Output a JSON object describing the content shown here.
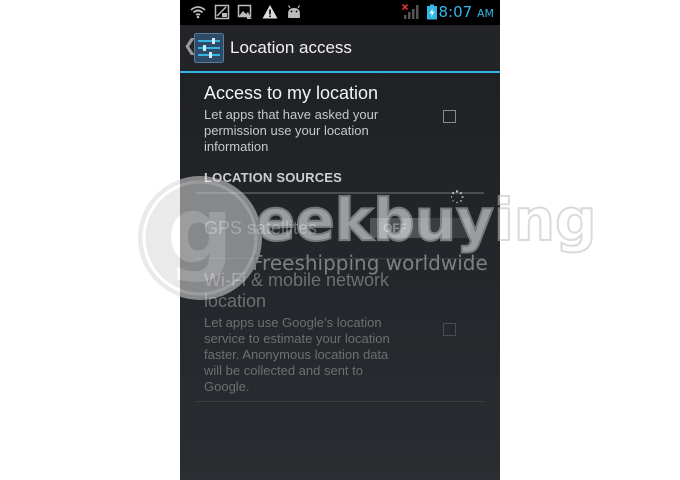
{
  "status_bar": {
    "time": "8:07",
    "ampm": "AM",
    "left_icons": [
      "wifi-icon",
      "screenshot-icon",
      "gallery-icon",
      "warning-icon",
      "android-icon"
    ],
    "right_icons": [
      "no-signal-icon",
      "battery-charging-icon"
    ],
    "accent_color": "#33b5e5"
  },
  "action_bar": {
    "title": "Location access",
    "app_icon": "location-settings-icon",
    "up_icon": "chevron-left-icon",
    "accent_color": "#33b5e5"
  },
  "prefs": {
    "access": {
      "title": "Access to my location",
      "summary_lines": [
        "Let apps that have asked your",
        "permission use your location",
        "information"
      ],
      "checked": false
    },
    "section_header": "LOCATION SOURCES",
    "gps": {
      "title": "GPS satellites",
      "toggle_label": "OFF",
      "enabled": false
    },
    "wifi": {
      "title_lines": [
        "Wi-Fi & mobile network",
        "location"
      ],
      "summary_lines": [
        "Let apps use Google’s location",
        "service to estimate your location",
        "faster. Anonymous location data",
        "will be collected and sent to",
        "Google."
      ],
      "checked": false,
      "enabled": false
    }
  },
  "watermark": {
    "brand": "eekbuying",
    "tagline": "Freeshipping worldwide",
    "logo_letter": "g"
  }
}
